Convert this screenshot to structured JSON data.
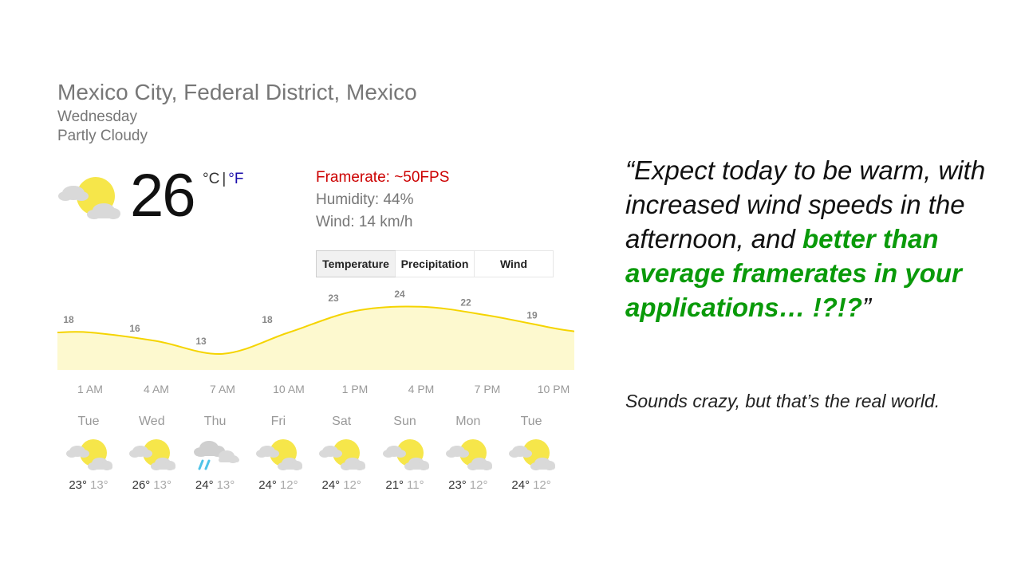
{
  "weather": {
    "location": "Mexico City, Federal District, Mexico",
    "day": "Wednesday",
    "condition": "Partly Cloudy",
    "current_icon": "partly-cloudy-icon",
    "temperature": "26",
    "units": {
      "celsius": "°C",
      "separator": "|",
      "fahrenheit": "°F"
    },
    "framerate": "Framerate: ~50FPS",
    "humidity": "Humidity: 44%",
    "wind": "Wind: 14 km/h",
    "tabs": [
      {
        "label": "Temperature",
        "active": true
      },
      {
        "label": "Precipitation",
        "active": false
      },
      {
        "label": "Wind",
        "active": false
      }
    ],
    "hourly_labels": [
      "1 AM",
      "4 AM",
      "7 AM",
      "10 AM",
      "1 PM",
      "4 PM",
      "7 PM",
      "10 PM"
    ],
    "hourly_temps": [
      "18",
      "16",
      "13",
      "18",
      "23",
      "24",
      "22",
      "19"
    ],
    "forecast": [
      {
        "day": "Tue",
        "icon": "partly-cloudy-icon",
        "high": "23°",
        "low": "13°"
      },
      {
        "day": "Wed",
        "icon": "partly-cloudy-icon",
        "high": "26°",
        "low": "13°"
      },
      {
        "day": "Thu",
        "icon": "rain-icon",
        "high": "24°",
        "low": "13°"
      },
      {
        "day": "Fri",
        "icon": "partly-cloudy-icon",
        "high": "24°",
        "low": "12°"
      },
      {
        "day": "Sat",
        "icon": "partly-cloudy-icon",
        "high": "24°",
        "low": "12°"
      },
      {
        "day": "Sun",
        "icon": "partly-cloudy-icon",
        "high": "21°",
        "low": "11°"
      },
      {
        "day": "Mon",
        "icon": "partly-cloudy-icon",
        "high": "23°",
        "low": "12°"
      },
      {
        "day": "Tue",
        "icon": "partly-cloudy-icon",
        "high": "24°",
        "low": "12°"
      }
    ],
    "colors": {
      "sun": "#f6e64a",
      "cloud": "#d9d9d9",
      "rain": "#4fc3e8",
      "chart_line": "#f5d400",
      "chart_fill": "#fdf9cf",
      "framerate": "#cc0000",
      "highlight": "#0a9a0a",
      "unit_link": "#1a0dab"
    }
  },
  "chart_data": {
    "type": "area",
    "x": [
      "1 AM",
      "4 AM",
      "7 AM",
      "10 AM",
      "1 PM",
      "4 PM",
      "7 PM",
      "10 PM"
    ],
    "series": [
      {
        "values": [
          18,
          16,
          13,
          18,
          23,
          24,
          22,
          19
        ]
      }
    ],
    "ylim": [
      10,
      26
    ],
    "grid": false
  },
  "quote": {
    "part1": "“Expect today to be warm, with increased wind speeds in the afternoon, and ",
    "highlight": "better than average framerates in your applications… !?!?",
    "part2": "”"
  },
  "footnote": "Sounds crazy, but that’s the real world."
}
